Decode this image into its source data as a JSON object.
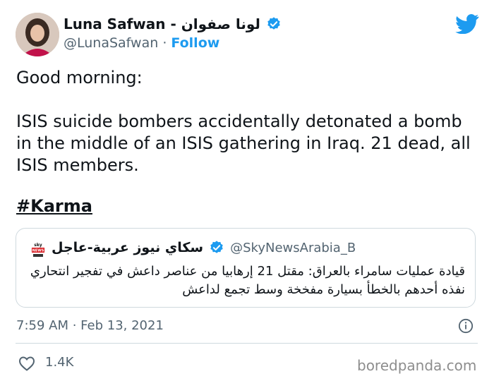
{
  "author": {
    "display_name": "Luna Safwan - لونا صفوان",
    "handle": "@LunaSafwan",
    "separator": "·",
    "follow_label": "Follow",
    "verified": true
  },
  "tweet": {
    "line1": "Good morning:",
    "line2": "ISIS suicide bombers accidentally detonated a bomb in the middle of an ISIS gathering in Iraq. 21 dead, all ISIS members.",
    "hashtag": "#Karma"
  },
  "quoted_tweet": {
    "display_name": "سكاي نيوز عربية-عاجل",
    "handle": "@SkyNewsArabia_B",
    "verified": true,
    "logo_text": "sky news عربية",
    "text": "قيادة عمليات سامراء بالعراق: مقتل 21 إرهابيا من عناصر داعش في تفجير انتحاري نفذه أحدهم بالخطأ بسيارة مفخخة وسط تجمع لداعش"
  },
  "meta": {
    "timestamp": "7:59 AM · Feb 13, 2021",
    "likes": "1.4K"
  },
  "watermark": "boredpanda.com",
  "colors": {
    "twitter_blue": "#1d9bf0",
    "secondary_text": "#536471",
    "border": "#cfd9de"
  },
  "icons": [
    "verified-badge-icon",
    "twitter-bird-icon",
    "info-icon",
    "heart-icon"
  ]
}
